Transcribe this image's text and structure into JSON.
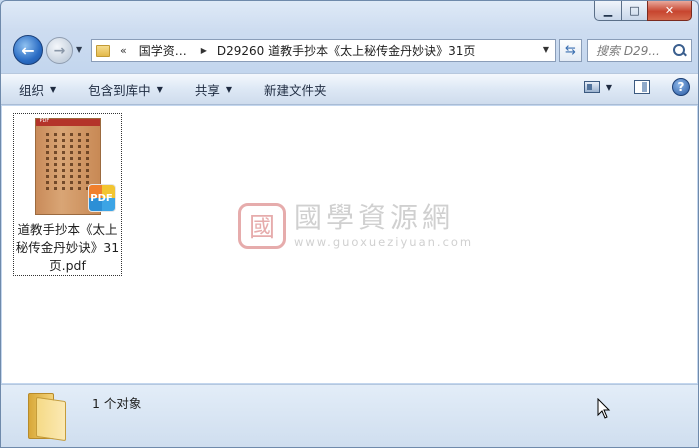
{
  "window": {
    "minimize_glyph": "▁",
    "maximize_glyph": "□",
    "close_glyph": "✕"
  },
  "nav": {
    "back_glyph": "←",
    "forward_glyph": "→",
    "history_drop_glyph": "▼"
  },
  "address": {
    "overflow_glyph": "«",
    "crumbs": [
      "国学资…",
      "D29260 道教手抄本《太上秘传金丹妙诀》31页"
    ],
    "separator_glyph": "▶",
    "drop_glyph": "▼"
  },
  "refresh": {
    "glyph": "⇆"
  },
  "search": {
    "placeholder": "搜索 D29..."
  },
  "toolbar": {
    "organize": "组织",
    "include_in_library": "包含到库中",
    "share": "共享",
    "new_folder": "新建文件夹",
    "dropdown_glyph": "▼",
    "help_glyph": "?"
  },
  "file": {
    "name": "道教手抄本《太上秘传金丹妙诀》31页.pdf",
    "thumb_banner": "PDF",
    "badge": "PDF"
  },
  "watermark": {
    "title": "國學資源網",
    "subtitle": "www.guoxueziyuan.com",
    "seal_glyph": "國"
  },
  "status": {
    "selection_count": "1 个对象"
  },
  "colors": {
    "accent": "#2a6cc4",
    "close_red": "#c7452f",
    "watermark_red": "#d36a6a"
  }
}
